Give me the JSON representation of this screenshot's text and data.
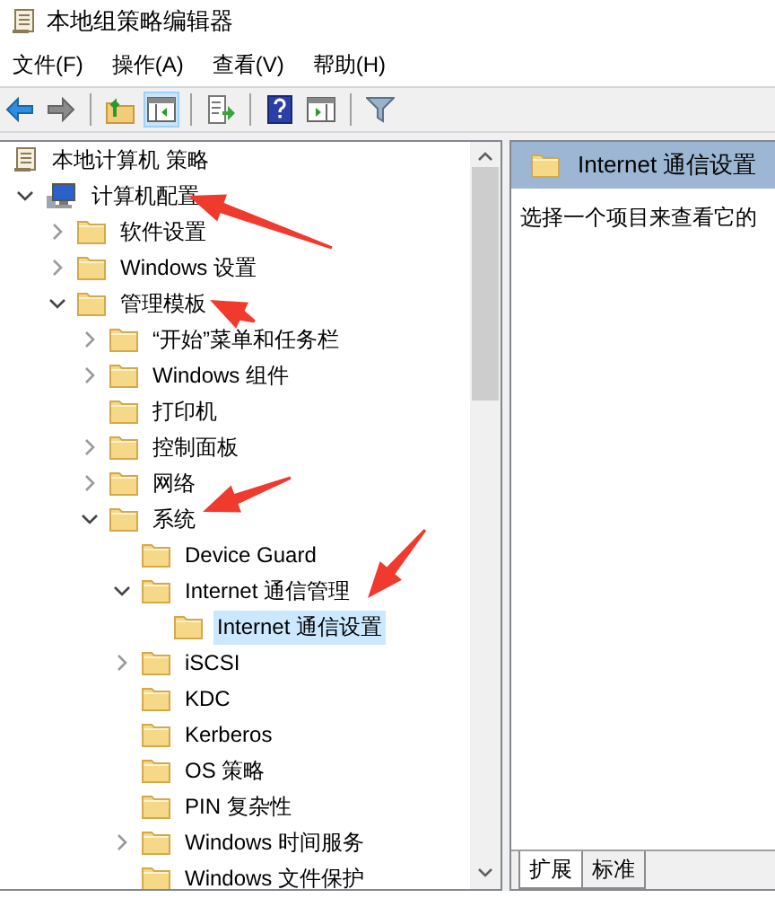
{
  "window": {
    "title": "本地组策略编辑器"
  },
  "menu": [
    "文件(F)",
    "操作(A)",
    "查看(V)",
    "帮助(H)"
  ],
  "toolbar_groups": [
    {
      "buttons": [
        {
          "kind": "back",
          "selected": false
        },
        {
          "kind": "forward",
          "selected": false
        }
      ]
    },
    {
      "buttons": [
        {
          "kind": "up",
          "selected": false
        },
        {
          "kind": "console-tree",
          "selected": true
        }
      ]
    },
    {
      "buttons": [
        {
          "kind": "export",
          "selected": false
        }
      ]
    },
    {
      "buttons": [
        {
          "kind": "help",
          "selected": false
        },
        {
          "kind": "action-pane",
          "selected": false
        }
      ]
    },
    {
      "buttons": [
        {
          "kind": "filter",
          "selected": false
        }
      ]
    }
  ],
  "tree": {
    "items": [
      {
        "label": "本地计算机 策略",
        "kind": "policy",
        "selected": false,
        "children": [
          {
            "label": "计算机配置",
            "kind": "computer",
            "expanded": true,
            "selected": false,
            "children": [
              {
                "label": "软件设置",
                "kind": "folder",
                "expanded": false,
                "selected": false
              },
              {
                "label": "Windows 设置",
                "kind": "folder",
                "expanded": false,
                "selected": false
              },
              {
                "label": "管理模板",
                "kind": "folder",
                "expanded": true,
                "selected": false,
                "children": [
                  {
                    "label": "“开始”菜单和任务栏",
                    "kind": "folder",
                    "expanded": false,
                    "selected": false
                  },
                  {
                    "label": "Windows 组件",
                    "kind": "folder",
                    "expanded": false,
                    "selected": false
                  },
                  {
                    "label": "打印机",
                    "kind": "folder",
                    "selected": false
                  },
                  {
                    "label": "控制面板",
                    "kind": "folder",
                    "expanded": false,
                    "selected": false
                  },
                  {
                    "label": "网络",
                    "kind": "folder",
                    "expanded": false,
                    "selected": false
                  },
                  {
                    "label": "系统",
                    "kind": "folder",
                    "expanded": true,
                    "selected": false,
                    "children": [
                      {
                        "label": "Device Guard",
                        "kind": "folder",
                        "selected": false
                      },
                      {
                        "label": "Internet 通信管理",
                        "kind": "folder",
                        "expanded": true,
                        "selected": false,
                        "children": [
                          {
                            "label": "Internet 通信设置",
                            "kind": "folder",
                            "selected": true
                          }
                        ]
                      },
                      {
                        "label": "iSCSI",
                        "kind": "folder",
                        "expanded": false,
                        "selected": false
                      },
                      {
                        "label": "KDC",
                        "kind": "folder",
                        "selected": false
                      },
                      {
                        "label": "Kerberos",
                        "kind": "folder",
                        "selected": false
                      },
                      {
                        "label": "OS 策略",
                        "kind": "folder",
                        "selected": false
                      },
                      {
                        "label": "PIN 复杂性",
                        "kind": "folder",
                        "selected": false
                      },
                      {
                        "label": "Windows 时间服务",
                        "kind": "folder",
                        "expanded": false,
                        "selected": false
                      },
                      {
                        "label": "Windows 文件保护",
                        "kind": "folder",
                        "selected": false
                      }
                    ]
                  }
                ]
              }
            ]
          }
        ]
      }
    ]
  },
  "detail": {
    "header": "Internet 通信设置",
    "description": "选择一个项目来查看它的",
    "tabs": [
      {
        "label": "扩展",
        "selected": true
      },
      {
        "label": "标准",
        "selected": false
      }
    ]
  }
}
